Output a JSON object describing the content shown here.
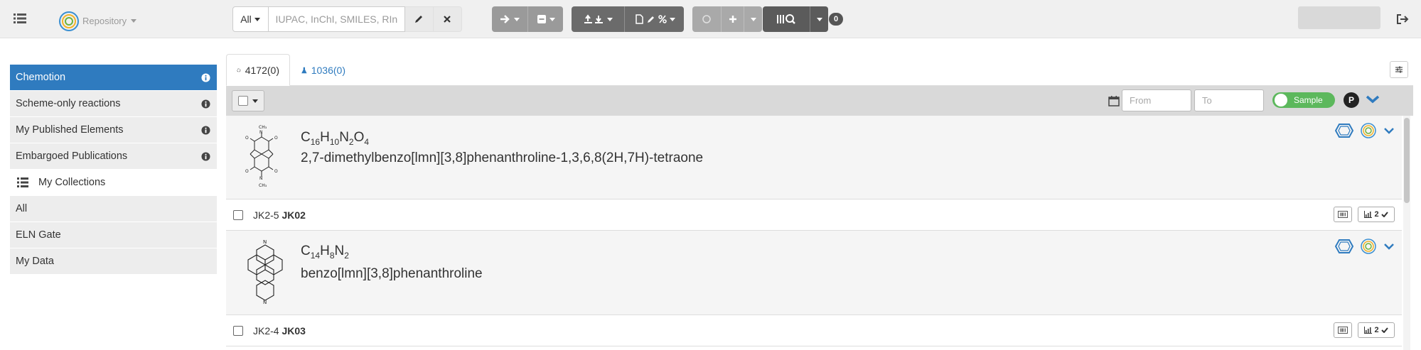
{
  "navbar": {
    "repository_label": "Repository",
    "search_scope": "All",
    "search_placeholder": "IUPAC, InChI, SMILES, RInChI...",
    "notification_count": "0"
  },
  "sidebar": {
    "items": [
      {
        "label": "Chemotion"
      },
      {
        "label": "Scheme-only reactions"
      },
      {
        "label": "My Published Elements"
      },
      {
        "label": "Embargoed Publications"
      }
    ],
    "collections_header": "My Collections",
    "collections": [
      {
        "label": "All"
      },
      {
        "label": "ELN Gate"
      },
      {
        "label": "My Data"
      }
    ]
  },
  "tabs": [
    {
      "label": "4172(0)"
    },
    {
      "label": "1036(0)"
    }
  ],
  "toolbar": {
    "from_placeholder": "From",
    "to_placeholder": "To",
    "toggle_label": "Sample",
    "p_badge": "P"
  },
  "molecules": [
    {
      "formula": {
        "parts": [
          "C",
          "16",
          "H",
          "10",
          "N",
          "2",
          "O",
          "4"
        ]
      },
      "name": "2,7-dimethylbenzo[lmn][3,8]phenanthroline-1,3,6,8(2H,7H)-tetraone",
      "sample": {
        "prefix": "JK2-5",
        "code": "JK02",
        "analyses_count": "2"
      }
    },
    {
      "formula": {
        "parts": [
          "C",
          "14",
          "H",
          "8",
          "N",
          "2"
        ]
      },
      "name": "benzo[lmn][3,8]phenanthroline",
      "sample": {
        "prefix": "JK2-4",
        "code": "JK03",
        "analyses_count": "2"
      }
    }
  ],
  "colors": {
    "active": "#2f7bbf",
    "toggle": "#5cb85c",
    "toolbar": "#d9d9d9"
  }
}
